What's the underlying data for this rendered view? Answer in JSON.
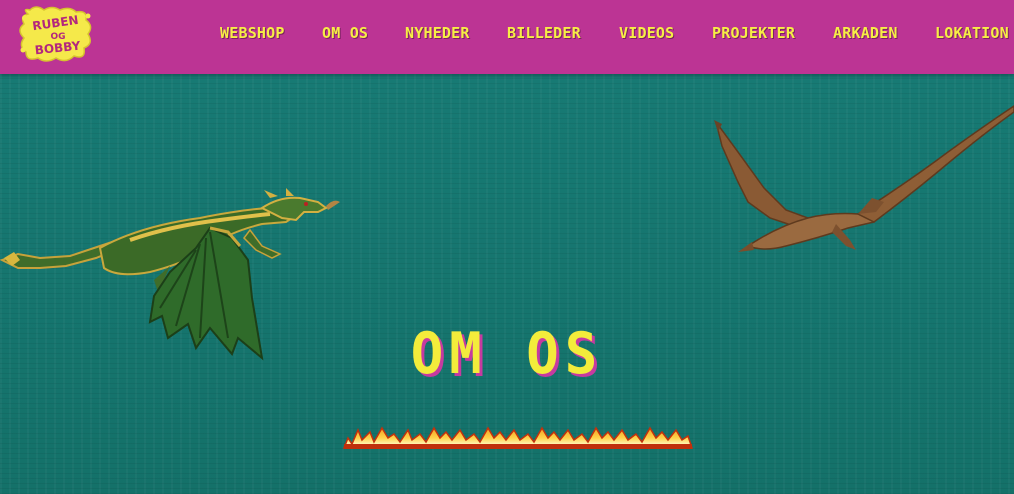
{
  "site": {
    "logo_text": "RUBEN OG BOBBY"
  },
  "nav": {
    "items": [
      {
        "label": "WEBSHOP"
      },
      {
        "label": "OM OS"
      },
      {
        "label": "NYHEDER"
      },
      {
        "label": "BILLEDER"
      },
      {
        "label": "VIDEOS"
      },
      {
        "label": "PROJEKTER"
      },
      {
        "label": "ARKADEN"
      },
      {
        "label": "LOKATION"
      }
    ]
  },
  "main": {
    "title": "OM OS"
  },
  "colors": {
    "nav_bg": "#bc3494",
    "nav_text": "#f7ee45",
    "page_bg": "#167a73",
    "title": "#f3ec3b",
    "title_shadow": "#c63aa0"
  },
  "decor": {
    "left_sprite": "green-dragon",
    "right_sprite": "brown-pterodactyl",
    "divider": "fire-line"
  }
}
